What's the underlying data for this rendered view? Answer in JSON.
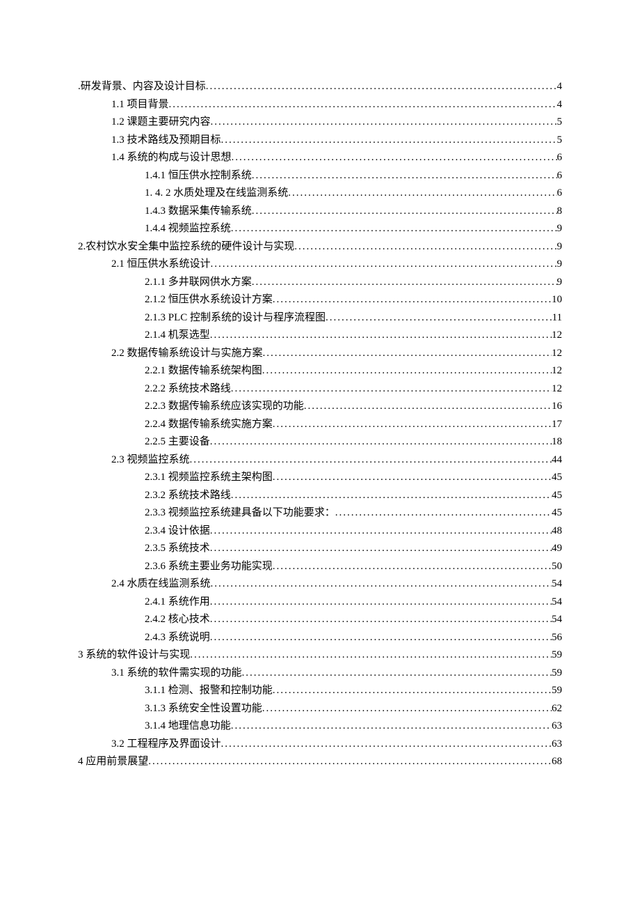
{
  "toc": [
    {
      "indent": 0,
      "title": ".研发背景、内容及设计目标",
      "page": "4"
    },
    {
      "indent": 1,
      "title": "1.1 项目背景",
      "page": "4"
    },
    {
      "indent": 1,
      "title": "1.2 课题主要研究内容",
      "page": "5"
    },
    {
      "indent": 1,
      "title": "1.3 技术路线及预期目标",
      "page": "5"
    },
    {
      "indent": 1,
      "title": "1.4 系统的构成与设计思想",
      "page": "6"
    },
    {
      "indent": 2,
      "title": "1.4.1 恒压供水控制系统",
      "page": "6"
    },
    {
      "indent": 2,
      "title": "1. 4. 2 水质处理及在线监测系统",
      "page": "6"
    },
    {
      "indent": 2,
      "title": "1.4.3 数据采集传输系统",
      "page": "8"
    },
    {
      "indent": 2,
      "title": "1.4.4 视频监控系统",
      "page": "9"
    },
    {
      "indent": 0,
      "title": "2.农村饮水安全集中监控系统的硬件设计与实现",
      "page": "9"
    },
    {
      "indent": 1,
      "title": "2.1 恒压供水系统设计",
      "page": "9"
    },
    {
      "indent": 2,
      "title": "2.1.1 多井联网供水方案",
      "page": "9"
    },
    {
      "indent": 2,
      "title": "2.1.2 恒压供水系统设计方案",
      "page": "10"
    },
    {
      "indent": 2,
      "title": "2.1.3 PLC 控制系统的设计与程序流程图 ",
      "page": "11"
    },
    {
      "indent": 2,
      "title": "2.1.4 机泵选型",
      "page": "12"
    },
    {
      "indent": 1,
      "title": "2.2 数据传输系统设计与实施方案",
      "page": "12"
    },
    {
      "indent": 2,
      "title": "2.2.1 数据传输系统架构图",
      "page": "12"
    },
    {
      "indent": 2,
      "title": "2.2.2 系统技术路线",
      "page": "12"
    },
    {
      "indent": 2,
      "title": "2.2.3 数据传输系统应该实现的功能",
      "page": "16"
    },
    {
      "indent": 2,
      "title": "2.2.4 数据传输系统实施方案",
      "page": "17"
    },
    {
      "indent": 2,
      "title": "2.2.5 主要设备",
      "page": "18"
    },
    {
      "indent": 1,
      "title": "2.3 视频监控系统",
      "page": "44"
    },
    {
      "indent": 2,
      "title": "2.3.1 视频监控系统主架构图",
      "page": "45"
    },
    {
      "indent": 2,
      "title": "2.3.2 系统技术路线",
      "page": "45"
    },
    {
      "indent": 2,
      "title": "2.3.3 视频监控系统建具备以下功能要求： ",
      "page": "45"
    },
    {
      "indent": 2,
      "title": "2.3.4 设计依据 ",
      "page": "48"
    },
    {
      "indent": 2,
      "title": "2.3.5 系统技术",
      "page": "49"
    },
    {
      "indent": 2,
      "title": "2.3.6 系统主要业务功能实现",
      "page": "50"
    },
    {
      "indent": 1,
      "title": "2.4 水质在线监测系统",
      "page": "54"
    },
    {
      "indent": 2,
      "title": "2.4.1 系统作用",
      "page": "54"
    },
    {
      "indent": 2,
      "title": "2.4.2 核心技术",
      "page": "54"
    },
    {
      "indent": 2,
      "title": "2.4.3 系统说明",
      "page": "56"
    },
    {
      "indent": 0,
      "title": "3 系统的软件设计与实现",
      "page": "59"
    },
    {
      "indent": 1,
      "title": "3.1 系统的软件需实现的功能",
      "page": "59"
    },
    {
      "indent": 2,
      "title": "3.1.1 检测、报警和控制功能",
      "page": "59"
    },
    {
      "indent": 2,
      "title": "3.1.3 系统安全性设置功能",
      "page": "62"
    },
    {
      "indent": 2,
      "title": "3.1.4 地理信息功能",
      "page": "63"
    },
    {
      "indent": 1,
      "title": "3.2 工程程序及界面设计",
      "page": "63"
    },
    {
      "indent": 0,
      "title": "4 应用前景展望",
      "page": "68"
    }
  ]
}
